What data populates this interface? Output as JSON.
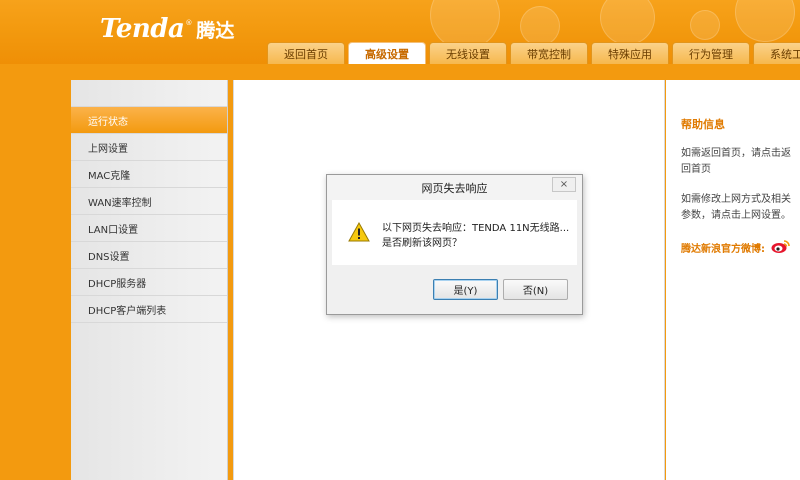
{
  "brand": {
    "name_en": "Tenda",
    "reg_mark": "®",
    "name_cn": "腾达"
  },
  "tabs": [
    {
      "label": "返回首页"
    },
    {
      "label": "高级设置",
      "active": true
    },
    {
      "label": "无线设置"
    },
    {
      "label": "带宽控制"
    },
    {
      "label": "特殊应用"
    },
    {
      "label": "行为管理"
    },
    {
      "label": "系统工具"
    }
  ],
  "sidebar": {
    "items": [
      {
        "label": "运行状态",
        "active": true
      },
      {
        "label": "上网设置"
      },
      {
        "label": "MAC克隆"
      },
      {
        "label": "WAN速率控制"
      },
      {
        "label": "LAN口设置"
      },
      {
        "label": "DNS设置"
      },
      {
        "label": "DHCP服务器"
      },
      {
        "label": "DHCP客户端列表"
      }
    ]
  },
  "help": {
    "title": "帮助信息",
    "paragraphs": [
      "如需返回首页，请点击返回首页",
      "如需修改上网方式及相关参数，请点击上网设置。"
    ],
    "weibo_label": "腾达新浪官方微博:"
  },
  "dialog": {
    "title": "网页失去响应",
    "close_glyph": "×",
    "message_line1": "以下网页失去响应：TENDA 11N无线路...",
    "message_line2": "是否刷新该网页？",
    "yes_label": "是(Y)",
    "no_label": "否(N)"
  },
  "colors": {
    "accent": "#f39a0f",
    "header": "#f7a21b",
    "help_title": "#e07a00"
  },
  "icons": {
    "dialog": "warning-icon",
    "social": "weibo-icon"
  }
}
